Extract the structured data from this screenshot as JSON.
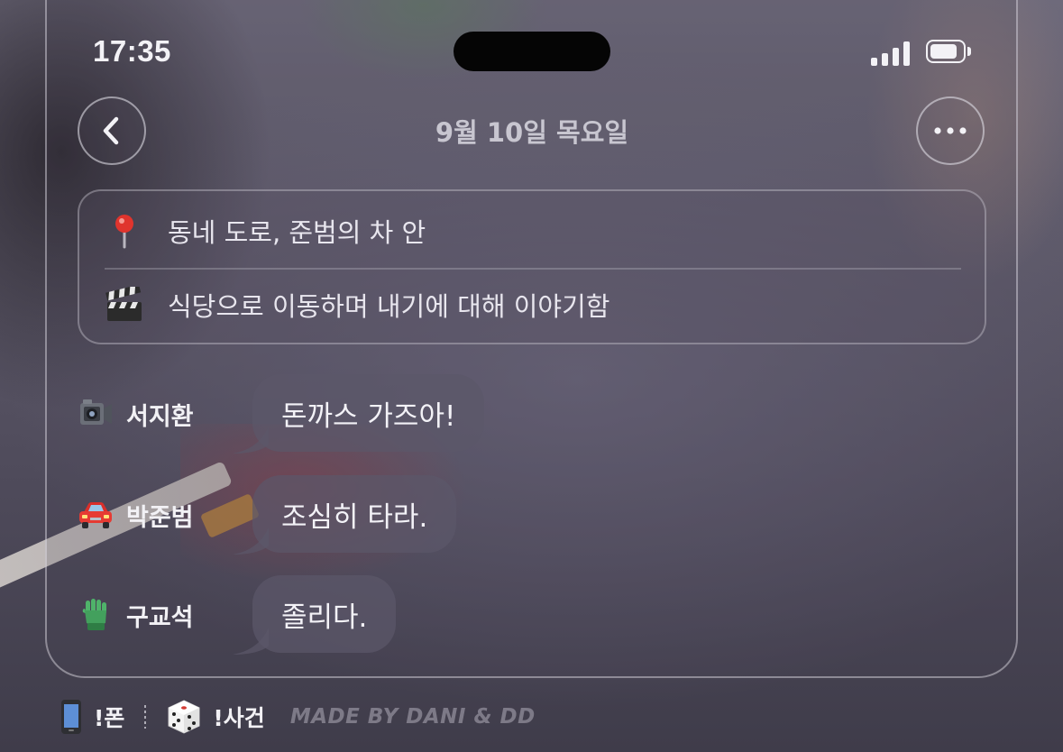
{
  "status_bar": {
    "time": "17:35",
    "signal_icon": "signal-bars-icon",
    "battery_icon": "battery-icon",
    "battery_level": 0.85
  },
  "header": {
    "date_title": "9월 10일 목요일",
    "back_icon": "chevron-left-icon",
    "more_icon": "ellipsis-icon"
  },
  "info_card": {
    "location_icon": "round-pushpin-icon",
    "location": "동네 도로, 준범의 차 안",
    "scene_icon": "clapper-board-icon",
    "scene": "식당으로 이동하며 내기에 대해 이야기함"
  },
  "messages": [
    {
      "sender_icon": "video-camera-icon",
      "sender": "서지환",
      "text": "돈까스 가즈아!"
    },
    {
      "sender_icon": "car-icon",
      "sender": "박준범",
      "text": "조심히 타라."
    },
    {
      "sender_icon": "green-glove-icon",
      "sender": "구교석",
      "text": "졸리다."
    }
  ],
  "footer": {
    "phone_icon": "mobile-phone-icon",
    "phone_label": "!폰",
    "dice_icon": "dice-icon",
    "event_label": "!사건",
    "credit": "MADE BY DANI & DD"
  },
  "colors": {
    "bubble": "#5c586a",
    "text": "#f3f2f7",
    "muted": "#c8c6d0",
    "island": "#050505"
  }
}
